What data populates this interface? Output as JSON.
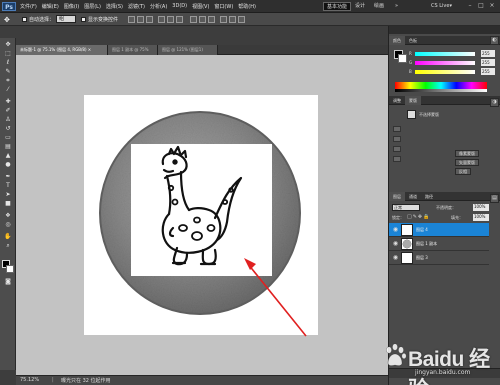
{
  "app": {
    "logo": "Ps",
    "menus": [
      "文件(F)",
      "编辑(E)",
      "图像(I)",
      "图层(L)",
      "选择(S)",
      "滤镜(T)",
      "分析(A)",
      "3D(D)",
      "视图(V)",
      "窗口(W)",
      "帮助(H)"
    ],
    "zoom": "75.1",
    "workspaces": [
      "基本功能",
      "设计",
      "绘画",
      "»"
    ],
    "cs_live": "CS Live▾"
  },
  "options_bar": {
    "auto_select_label": "自动选择：",
    "auto_select_value": "组",
    "transform_label": "显示变换控件"
  },
  "document_tabs": [
    {
      "label": "未标题-1 @ 75.1% (图层 4, RGB/8) ×",
      "active": true
    },
    {
      "label": "图层 1 副本 @ 75%",
      "active": false
    },
    {
      "label": "图层 @ 121% (图层1)",
      "active": false
    }
  ],
  "status_bar": {
    "zoom": "75.12%",
    "info": "曝光只在 32 位起作用"
  },
  "panels": {
    "color_tab": "颜色",
    "swatches_tab": "色板",
    "sliders": [
      {
        "label": "R",
        "value": "255",
        "color": "#ff4040"
      },
      {
        "label": "G",
        "value": "255",
        "color": "#40ff40"
      },
      {
        "label": "B",
        "value": "255",
        "color": "#4040ff"
      }
    ],
    "adjust_tab": "调整",
    "masks_tab": "蒙版",
    "adjust_hint": "不选择蒙版",
    "mask_buttons": [
      "像素蒙版",
      "矢量蒙版",
      "反相"
    ],
    "layers_tab": "图层",
    "channels_tab": "通道",
    "paths_tab": "路径",
    "blend_mode": "正常",
    "opacity_label": "不透明度：",
    "opacity": "100%",
    "lock_label": "锁定：",
    "fill_label": "填充：",
    "fill": "100%",
    "layers": [
      {
        "name": "图层 4",
        "selected": true
      },
      {
        "name": "图层 1 副本",
        "selected": false
      },
      {
        "name": "图层 3",
        "selected": false
      }
    ]
  },
  "watermark": {
    "text": "Baidu 经验",
    "sub": "jingyan.baidu.com"
  },
  "colors": {
    "accent_selection": "#1b84d6",
    "arrow": "#e02020"
  }
}
